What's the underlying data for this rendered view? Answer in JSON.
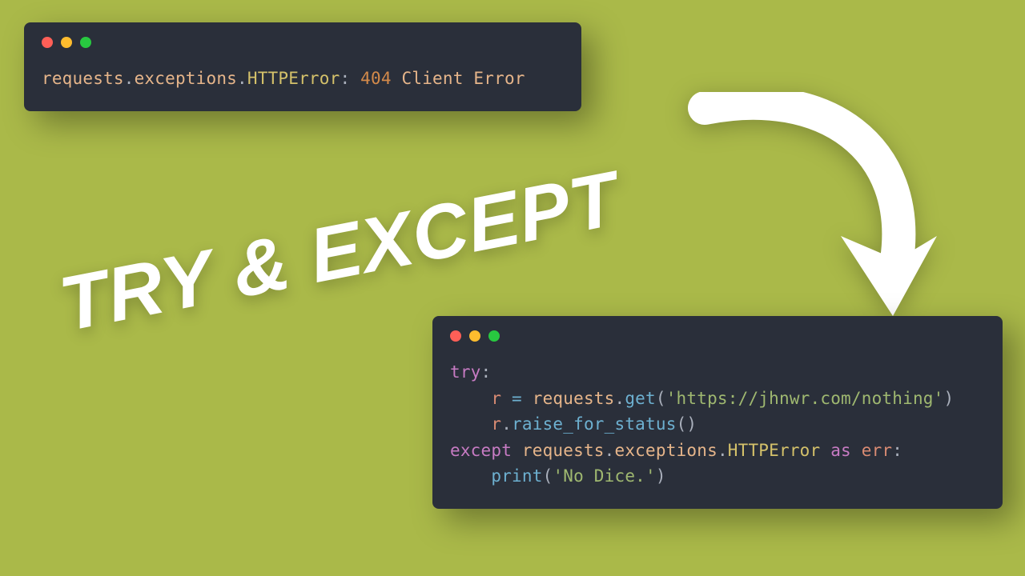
{
  "headline": "TRY & EXCEPT",
  "win1": {
    "tokens": [
      {
        "t": "requests",
        "c": "c-mod"
      },
      {
        "t": ".",
        "c": "c-dot"
      },
      {
        "t": "exceptions",
        "c": "c-mod"
      },
      {
        "t": ".",
        "c": "c-dot"
      },
      {
        "t": "HTTPError",
        "c": "c-cls"
      },
      {
        "t": ": ",
        "c": "c-punc"
      },
      {
        "t": "404",
        "c": "c-num"
      },
      {
        "t": " Client Error",
        "c": "c-mod"
      }
    ]
  },
  "win2": {
    "lines": [
      [
        {
          "t": "try",
          "c": "c-kw"
        },
        {
          "t": ":",
          "c": "c-punc"
        }
      ],
      [
        {
          "t": "    ",
          "c": ""
        },
        {
          "t": "r",
          "c": "c-var"
        },
        {
          "t": " = ",
          "c": "c-op"
        },
        {
          "t": "requests",
          "c": "c-mod"
        },
        {
          "t": ".",
          "c": "c-dot"
        },
        {
          "t": "get",
          "c": "c-call"
        },
        {
          "t": "(",
          "c": "c-punc"
        },
        {
          "t": "'https://jhnwr.com/nothing'",
          "c": "c-str"
        },
        {
          "t": ")",
          "c": "c-punc"
        }
      ],
      [
        {
          "t": "    ",
          "c": ""
        },
        {
          "t": "r",
          "c": "c-var"
        },
        {
          "t": ".",
          "c": "c-dot"
        },
        {
          "t": "raise_for_status",
          "c": "c-call"
        },
        {
          "t": "()",
          "c": "c-punc"
        }
      ],
      [
        {
          "t": "except",
          "c": "c-kw"
        },
        {
          "t": " ",
          "c": ""
        },
        {
          "t": "requests",
          "c": "c-mod"
        },
        {
          "t": ".",
          "c": "c-dot"
        },
        {
          "t": "exceptions",
          "c": "c-mod"
        },
        {
          "t": ".",
          "c": "c-dot"
        },
        {
          "t": "HTTPError",
          "c": "c-cls"
        },
        {
          "t": " as ",
          "c": "c-kw"
        },
        {
          "t": "err",
          "c": "c-var"
        },
        {
          "t": ":",
          "c": "c-punc"
        }
      ],
      [
        {
          "t": "    ",
          "c": ""
        },
        {
          "t": "print",
          "c": "c-call"
        },
        {
          "t": "(",
          "c": "c-punc"
        },
        {
          "t": "'No Dice.'",
          "c": "c-str"
        },
        {
          "t": ")",
          "c": "c-punc"
        }
      ]
    ]
  }
}
